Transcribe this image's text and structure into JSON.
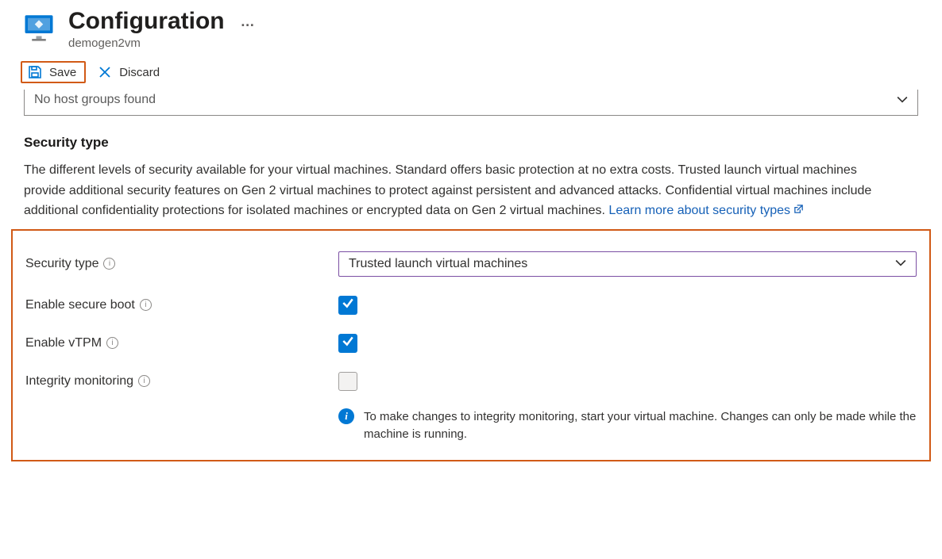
{
  "header": {
    "title": "Configuration",
    "resource": "demogen2vm"
  },
  "toolbar": {
    "save_label": "Save",
    "discard_label": "Discard"
  },
  "host_group_dropdown": {
    "text": "No host groups found"
  },
  "security": {
    "title": "Security type",
    "description": "The different levels of security available for your virtual machines. Standard offers basic protection at no extra costs. Trusted launch virtual machines provide additional security features on Gen 2 virtual machines to protect against persistent and advanced attacks. Confidential virtual machines include additional confidentiality protections for isolated machines or encrypted data on Gen 2 virtual machines.",
    "learn_more": "Learn more about security types",
    "fields": {
      "security_type_label": "Security type",
      "security_type_value": "Trusted launch virtual machines",
      "secure_boot_label": "Enable secure boot",
      "vtpm_label": "Enable vTPM",
      "integrity_label": "Integrity monitoring",
      "integrity_info": "To make changes to integrity monitoring, start your virtual machine. Changes can only be made while the machine is running."
    }
  }
}
